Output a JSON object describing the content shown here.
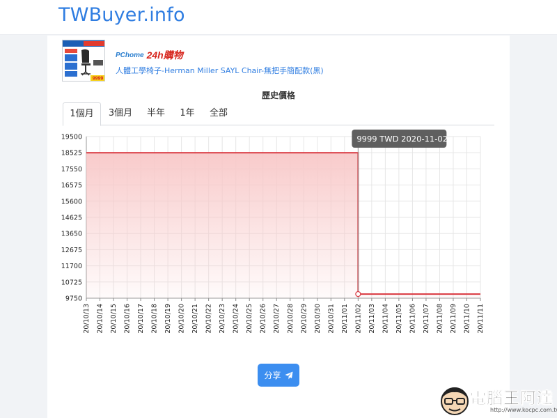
{
  "site": {
    "brand": "TWBuyer.info"
  },
  "product": {
    "store_logo_prefix": "PChome",
    "store_logo_main": "24h購物",
    "name": "人體工學椅子-Herman Miller SAYL Chair-無把手簡配款(黑)",
    "thumb_price": "9999"
  },
  "history": {
    "title": "歷史價格",
    "tabs": [
      {
        "label": "1個月",
        "active": true
      },
      {
        "label": "3個月",
        "active": false
      },
      {
        "label": "半年",
        "active": false
      },
      {
        "label": "1年",
        "active": false
      },
      {
        "label": "全部",
        "active": false
      }
    ]
  },
  "tooltip": {
    "text": "9999 TWD 2020-11-02"
  },
  "share": {
    "label": "分享"
  },
  "watermark": {
    "text": "電腦王阿達",
    "url": "http://www.kocpc.com.tw"
  },
  "colors": {
    "accent": "#2f7de1",
    "line": "#d9363e",
    "fill": "#f8c8c8",
    "button": "#3c8ef0"
  },
  "chart_data": {
    "type": "area",
    "ylim": [
      9750,
      19500
    ],
    "yticks": [
      19500,
      18525,
      17550,
      16575,
      15600,
      14625,
      13650,
      12675,
      11700,
      10725,
      9750
    ],
    "xticks": [
      "20/10/13",
      "20/10/14",
      "20/10/15",
      "20/10/16",
      "20/10/17",
      "20/10/18",
      "20/10/19",
      "20/10/20",
      "20/10/21",
      "20/10/22",
      "20/10/23",
      "20/10/24",
      "20/10/25",
      "20/10/26",
      "20/10/27",
      "20/10/28",
      "20/10/29",
      "20/10/30",
      "20/10/31",
      "20/11/01",
      "20/11/02",
      "20/11/03",
      "20/11/04",
      "20/11/05",
      "20/11/06",
      "20/11/07",
      "20/11/08",
      "20/11/09",
      "20/11/10",
      "20/11/11"
    ],
    "currency": "TWD",
    "step": "before",
    "points": [
      {
        "x": "20/10/13",
        "y": 18525
      },
      {
        "x": "20/11/01",
        "y": 18525
      },
      {
        "x": "20/11/02",
        "y": 9999
      },
      {
        "x": "20/11/11",
        "y": 9999
      }
    ],
    "highlight": {
      "x": "20/11/02",
      "y": 9999
    },
    "grid": true
  }
}
